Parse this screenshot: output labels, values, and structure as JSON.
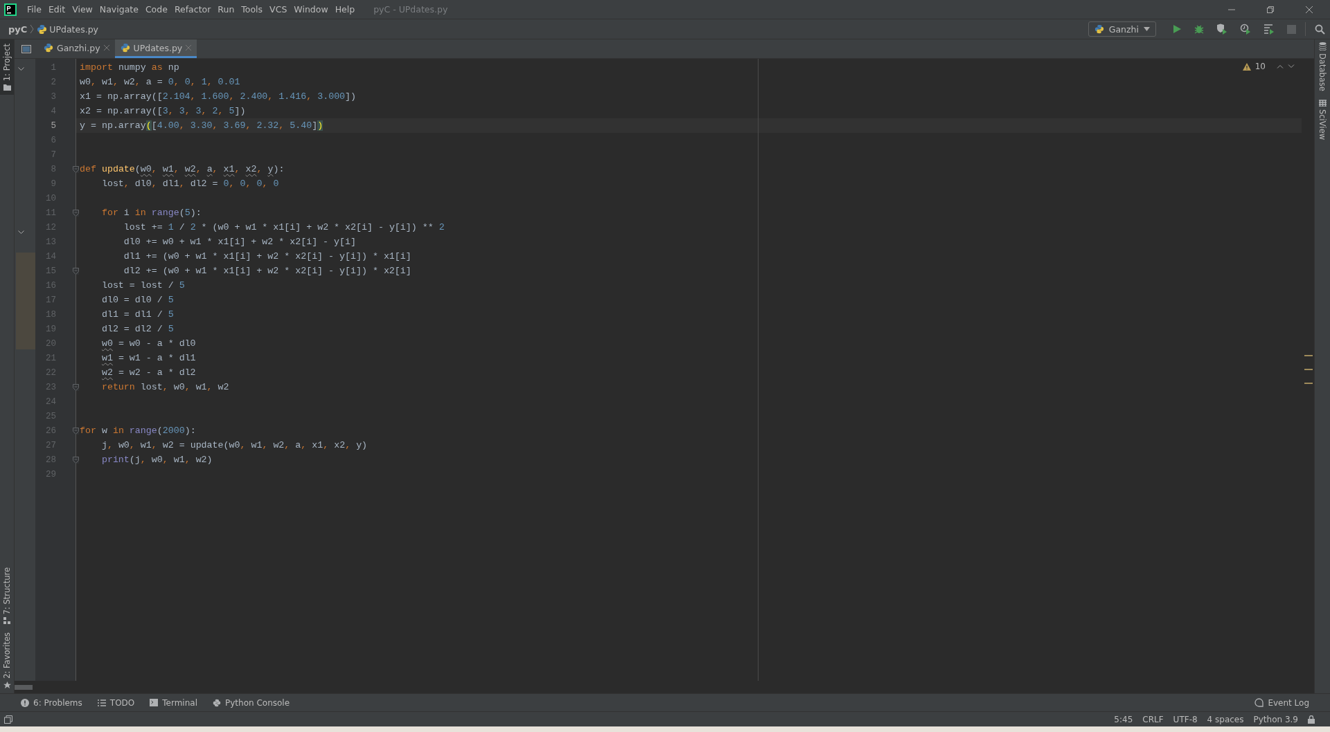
{
  "window": {
    "title": "pyC - UPdates.py"
  },
  "menu": [
    "File",
    "Edit",
    "View",
    "Navigate",
    "Code",
    "Refactor",
    "Run",
    "Tools",
    "VCS",
    "Window",
    "Help"
  ],
  "breadcrumb": {
    "project": "pyC",
    "file": "UPdates.py"
  },
  "run_config": {
    "label": "Ganzhi"
  },
  "tabs": [
    {
      "label": "Ganzhi.py",
      "selected": false
    },
    {
      "label": "UPdates.py",
      "selected": true
    }
  ],
  "left_stripe": {
    "top": [
      {
        "label": "1: Project",
        "kind": "project",
        "selected": true
      }
    ],
    "bottom": [
      {
        "label": "7: Structure",
        "kind": "structure",
        "selected": false
      },
      {
        "label": "2: Favorites",
        "kind": "favorites",
        "selected": false
      }
    ]
  },
  "right_stripe": [
    {
      "label": "Database",
      "kind": "database"
    },
    {
      "label": "SciView",
      "kind": "grid"
    }
  ],
  "inspections": {
    "count": "10"
  },
  "code_lines": [
    {
      "number": "1",
      "current": false,
      "fold": false,
      "tokens": [
        {
          "kind": "kw",
          "t": "import"
        },
        {
          "kind": "plain",
          "t": " numpy "
        },
        {
          "kind": "kw",
          "t": "as"
        },
        {
          "kind": "plain",
          "t": " np"
        }
      ]
    },
    {
      "number": "2",
      "current": false,
      "fold": false,
      "tokens": [
        {
          "kind": "plain",
          "t": "w0"
        },
        {
          "kind": "punct",
          "t": ", "
        },
        {
          "kind": "plain",
          "t": "w1"
        },
        {
          "kind": "punct",
          "t": ", "
        },
        {
          "kind": "plain",
          "t": "w2"
        },
        {
          "kind": "punct",
          "t": ", "
        },
        {
          "kind": "plain",
          "t": "a = "
        },
        {
          "kind": "num",
          "t": "0"
        },
        {
          "kind": "punct",
          "t": ", "
        },
        {
          "kind": "num",
          "t": "0"
        },
        {
          "kind": "punct",
          "t": ", "
        },
        {
          "kind": "num",
          "t": "1"
        },
        {
          "kind": "punct",
          "t": ", "
        },
        {
          "kind": "num",
          "t": "0.01"
        }
      ]
    },
    {
      "number": "3",
      "current": false,
      "fold": false,
      "tokens": [
        {
          "kind": "plain",
          "t": "x1 = np.array(["
        },
        {
          "kind": "num",
          "t": "2.104"
        },
        {
          "kind": "punct",
          "t": ", "
        },
        {
          "kind": "num",
          "t": "1.600"
        },
        {
          "kind": "punct",
          "t": ", "
        },
        {
          "kind": "num",
          "t": "2.400"
        },
        {
          "kind": "punct",
          "t": ", "
        },
        {
          "kind": "num",
          "t": "1.416"
        },
        {
          "kind": "punct",
          "t": ", "
        },
        {
          "kind": "num",
          "t": "3.000"
        },
        {
          "kind": "plain",
          "t": "])"
        }
      ]
    },
    {
      "number": "4",
      "current": false,
      "fold": false,
      "tokens": [
        {
          "kind": "plain",
          "t": "x2 = np.array(["
        },
        {
          "kind": "num",
          "t": "3"
        },
        {
          "kind": "punct",
          "t": ", "
        },
        {
          "kind": "num",
          "t": "3"
        },
        {
          "kind": "punct",
          "t": ", "
        },
        {
          "kind": "num",
          "t": "3"
        },
        {
          "kind": "punct",
          "t": ", "
        },
        {
          "kind": "num",
          "t": "2"
        },
        {
          "kind": "punct",
          "t": ", "
        },
        {
          "kind": "num",
          "t": "5"
        },
        {
          "kind": "plain",
          "t": "])"
        }
      ]
    },
    {
      "number": "5",
      "current": true,
      "fold": false,
      "tokens": [
        {
          "kind": "plain",
          "t": "y = np.array"
        },
        {
          "kind": "match",
          "t": "("
        },
        {
          "kind": "plain",
          "t": "["
        },
        {
          "kind": "num",
          "t": "4.00"
        },
        {
          "kind": "punct",
          "t": ", "
        },
        {
          "kind": "num",
          "t": "3.30"
        },
        {
          "kind": "punct",
          "t": ", "
        },
        {
          "kind": "num",
          "t": "3.69"
        },
        {
          "kind": "punct",
          "t": ", "
        },
        {
          "kind": "num",
          "t": "2.32"
        },
        {
          "kind": "punct",
          "t": ", "
        },
        {
          "kind": "num",
          "t": "5.40"
        },
        {
          "kind": "plain",
          "t": "]"
        },
        {
          "kind": "match",
          "t": ")"
        }
      ]
    },
    {
      "number": "6",
      "current": false,
      "fold": false
    },
    {
      "number": "7",
      "current": false,
      "fold": false
    },
    {
      "number": "8",
      "current": false,
      "fold": true,
      "tokens": [
        {
          "kind": "kw",
          "t": "def"
        },
        {
          "kind": "func",
          "t": " update"
        },
        {
          "kind": "plain",
          "t": "("
        },
        {
          "kind": "param",
          "t": "w0"
        },
        {
          "kind": "punct",
          "t": ", "
        },
        {
          "kind": "param",
          "t": "w1"
        },
        {
          "kind": "punct",
          "t": ", "
        },
        {
          "kind": "param",
          "t": "w2"
        },
        {
          "kind": "punct",
          "t": ", "
        },
        {
          "kind": "param",
          "t": "a"
        },
        {
          "kind": "punct",
          "t": ", "
        },
        {
          "kind": "param",
          "t": "x1"
        },
        {
          "kind": "punct",
          "t": ", "
        },
        {
          "kind": "param",
          "t": "x2"
        },
        {
          "kind": "punct",
          "t": ", "
        },
        {
          "kind": "param",
          "t": "y"
        },
        {
          "kind": "plain",
          "t": "):"
        }
      ]
    },
    {
      "number": "9",
      "current": false,
      "fold": false,
      "tokens": [
        {
          "kind": "plain",
          "t": "    lost"
        },
        {
          "kind": "punct",
          "t": ", "
        },
        {
          "kind": "plain",
          "t": "dl0"
        },
        {
          "kind": "punct",
          "t": ", "
        },
        {
          "kind": "plain",
          "t": "dl1"
        },
        {
          "kind": "punct",
          "t": ", "
        },
        {
          "kind": "plain",
          "t": "dl2 = "
        },
        {
          "kind": "num",
          "t": "0"
        },
        {
          "kind": "punct",
          "t": ", "
        },
        {
          "kind": "num",
          "t": "0"
        },
        {
          "kind": "punct",
          "t": ", "
        },
        {
          "kind": "num",
          "t": "0"
        },
        {
          "kind": "punct",
          "t": ", "
        },
        {
          "kind": "num",
          "t": "0"
        }
      ]
    },
    {
      "number": "10",
      "current": false,
      "fold": false
    },
    {
      "number": "11",
      "current": false,
      "fold": true,
      "tokens": [
        {
          "kind": "kw",
          "t": "    for"
        },
        {
          "kind": "plain",
          "t": " i "
        },
        {
          "kind": "kw",
          "t": "in"
        },
        {
          "kind": "builtin",
          "t": " range"
        },
        {
          "kind": "plain",
          "t": "("
        },
        {
          "kind": "num",
          "t": "5"
        },
        {
          "kind": "plain",
          "t": "):"
        }
      ]
    },
    {
      "number": "12",
      "current": false,
      "fold": false,
      "tokens": [
        {
          "kind": "plain",
          "t": "        lost += "
        },
        {
          "kind": "num",
          "t": "1"
        },
        {
          "kind": "plain",
          "t": " / "
        },
        {
          "kind": "num",
          "t": "2"
        },
        {
          "kind": "plain",
          "t": " * (w0 + w1 * x1[i] + w2 * x2[i] - y[i]) ** "
        },
        {
          "kind": "num",
          "t": "2"
        }
      ]
    },
    {
      "number": "13",
      "current": false,
      "fold": false,
      "tokens": [
        {
          "kind": "plain",
          "t": "        dl0 += w0 + w1 * x1[i] + w2 * x2[i] - y[i]"
        }
      ]
    },
    {
      "number": "14",
      "current": false,
      "fold": false,
      "tokens": [
        {
          "kind": "plain",
          "t": "        dl1 += (w0 + w1 * x1[i] + w2 * x2[i] - y[i]) * x1[i]"
        }
      ]
    },
    {
      "number": "15",
      "current": false,
      "fold": true,
      "tokens": [
        {
          "kind": "plain",
          "t": "        dl2 += (w0 + w1 * x1[i] + w2 * x2[i] - y[i]) * x2[i]"
        }
      ]
    },
    {
      "number": "16",
      "current": false,
      "fold": false,
      "tokens": [
        {
          "kind": "plain",
          "t": "    lost = lost / "
        },
        {
          "kind": "num",
          "t": "5"
        }
      ]
    },
    {
      "number": "17",
      "current": false,
      "fold": false,
      "tokens": [
        {
          "kind": "plain",
          "t": "    dl0 = dl0 / "
        },
        {
          "kind": "num",
          "t": "5"
        }
      ]
    },
    {
      "number": "18",
      "current": false,
      "fold": false,
      "tokens": [
        {
          "kind": "plain",
          "t": "    dl1 = dl1 / "
        },
        {
          "kind": "num",
          "t": "5"
        }
      ]
    },
    {
      "number": "19",
      "current": false,
      "fold": false,
      "tokens": [
        {
          "kind": "plain",
          "t": "    dl2 = dl2 / "
        },
        {
          "kind": "num",
          "t": "5"
        }
      ]
    },
    {
      "number": "20",
      "current": false,
      "fold": false,
      "tokens": [
        {
          "kind": "param",
          "t": "    w0"
        },
        {
          "kind": "plain",
          "t": " = w0 - a * dl0"
        }
      ]
    },
    {
      "number": "21",
      "current": false,
      "fold": false,
      "tokens": [
        {
          "kind": "param",
          "t": "    w1"
        },
        {
          "kind": "plain",
          "t": " = w1 - a * dl1"
        }
      ]
    },
    {
      "number": "22",
      "current": false,
      "fold": false,
      "tokens": [
        {
          "kind": "param",
          "t": "    w2"
        },
        {
          "kind": "plain",
          "t": " = w2 - a * dl2"
        }
      ]
    },
    {
      "number": "23",
      "current": false,
      "fold": true,
      "tokens": [
        {
          "kind": "kw",
          "t": "    return"
        },
        {
          "kind": "plain",
          "t": " lost"
        },
        {
          "kind": "punct",
          "t": ", "
        },
        {
          "kind": "plain",
          "t": "w0"
        },
        {
          "kind": "punct",
          "t": ", "
        },
        {
          "kind": "plain",
          "t": "w1"
        },
        {
          "kind": "punct",
          "t": ", "
        },
        {
          "kind": "plain",
          "t": "w2"
        }
      ]
    },
    {
      "number": "24",
      "current": false,
      "fold": false
    },
    {
      "number": "25",
      "current": false,
      "fold": false
    },
    {
      "number": "26",
      "current": false,
      "fold": true,
      "tokens": [
        {
          "kind": "kw",
          "t": "for"
        },
        {
          "kind": "plain",
          "t": " w "
        },
        {
          "kind": "kw",
          "t": "in"
        },
        {
          "kind": "builtin",
          "t": " range"
        },
        {
          "kind": "plain",
          "t": "("
        },
        {
          "kind": "num",
          "t": "2000"
        },
        {
          "kind": "plain",
          "t": "):"
        }
      ]
    },
    {
      "number": "27",
      "current": false,
      "fold": false,
      "tokens": [
        {
          "kind": "plain",
          "t": "    j"
        },
        {
          "kind": "punct",
          "t": ", "
        },
        {
          "kind": "plain",
          "t": "w0"
        },
        {
          "kind": "punct",
          "t": ", "
        },
        {
          "kind": "plain",
          "t": "w1"
        },
        {
          "kind": "punct",
          "t": ", "
        },
        {
          "kind": "plain",
          "t": "w2 = update(w0"
        },
        {
          "kind": "punct",
          "t": ", "
        },
        {
          "kind": "plain",
          "t": "w1"
        },
        {
          "kind": "punct",
          "t": ", "
        },
        {
          "kind": "plain",
          "t": "w2"
        },
        {
          "kind": "punct",
          "t": ", "
        },
        {
          "kind": "plain",
          "t": "a"
        },
        {
          "kind": "punct",
          "t": ", "
        },
        {
          "kind": "plain",
          "t": "x1"
        },
        {
          "kind": "punct",
          "t": ", "
        },
        {
          "kind": "plain",
          "t": "x2"
        },
        {
          "kind": "punct",
          "t": ", "
        },
        {
          "kind": "plain",
          "t": "y)"
        }
      ]
    },
    {
      "number": "28",
      "current": false,
      "fold": true,
      "tokens": [
        {
          "kind": "builtin",
          "t": "    print"
        },
        {
          "kind": "plain",
          "t": "(j"
        },
        {
          "kind": "punct",
          "t": ", "
        },
        {
          "kind": "plain",
          "t": "w0"
        },
        {
          "kind": "punct",
          "t": ", "
        },
        {
          "kind": "plain",
          "t": "w1"
        },
        {
          "kind": "punct",
          "t": ", "
        },
        {
          "kind": "plain",
          "t": "w2)"
        }
      ]
    },
    {
      "number": "29",
      "current": false,
      "fold": false
    }
  ],
  "tool_windows": [
    {
      "label": "6: Problems",
      "kind": "problems"
    },
    {
      "label": "TODO",
      "kind": "todo"
    },
    {
      "label": "Terminal",
      "kind": "terminal"
    },
    {
      "label": "Python Console",
      "kind": "python"
    }
  ],
  "event_log": {
    "label": "Event Log"
  },
  "status_bar": [
    "5:45",
    "CRLF",
    "UTF-8",
    "4 spaces",
    "Python 3.9"
  ]
}
